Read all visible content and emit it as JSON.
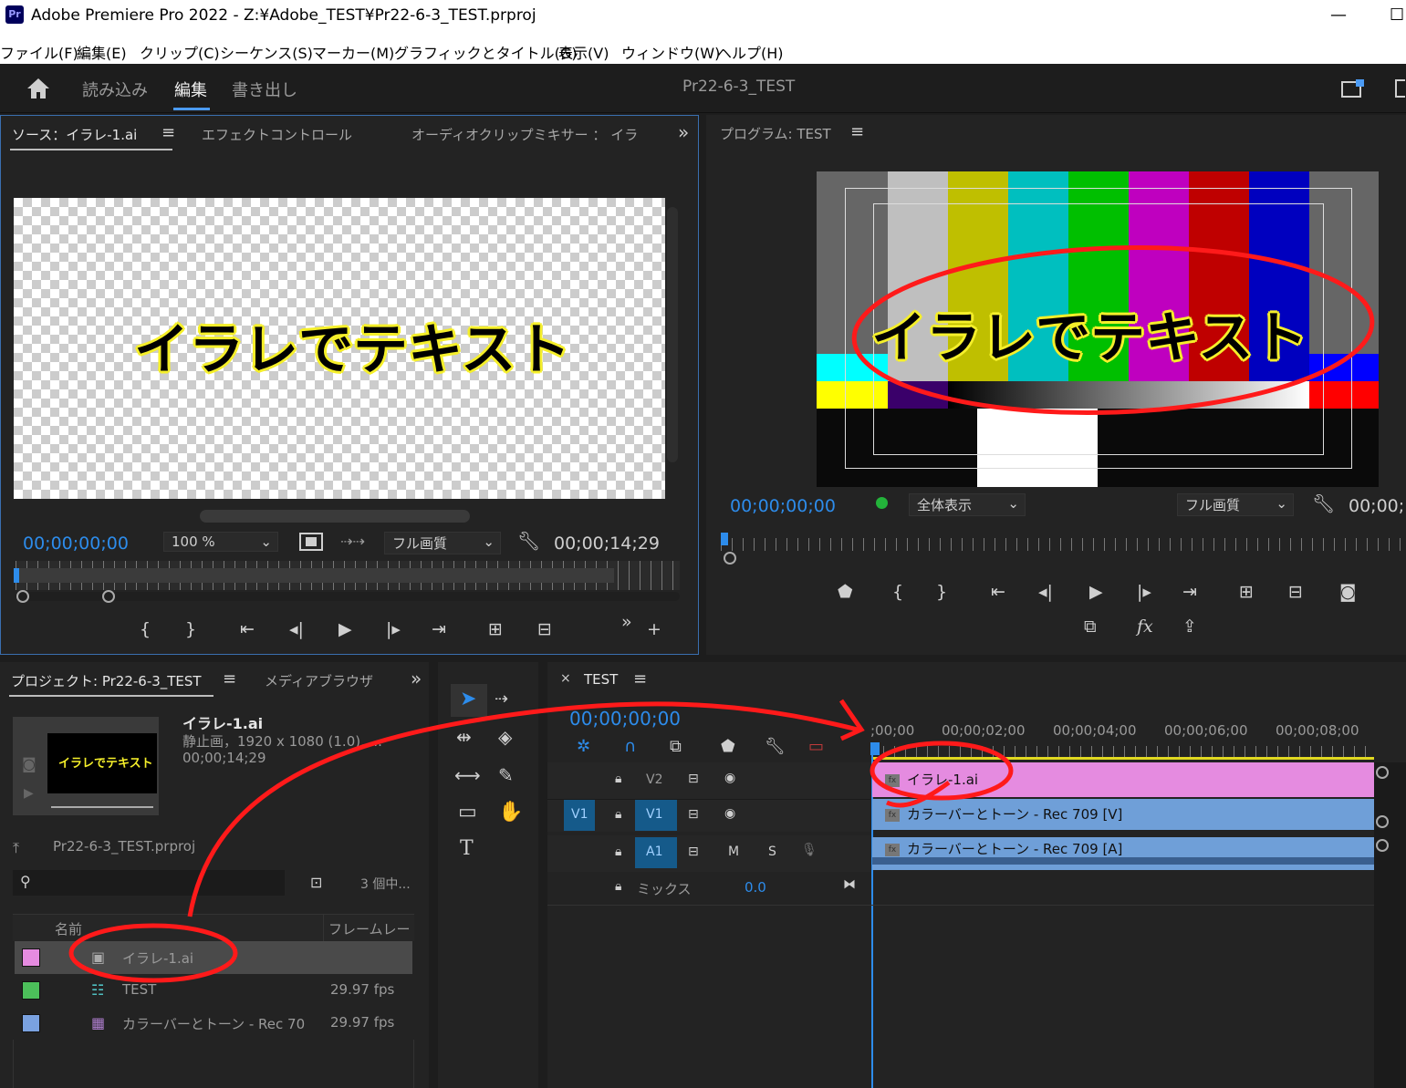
{
  "window": {
    "title": "Adobe Premiere Pro 2022 - Z:¥Adobe_TEST¥Pr22-6-3_TEST.prproj",
    "app_icon": "Pr"
  },
  "menu": [
    "ファイル(F)",
    "編集(E)",
    "クリップ(C)",
    "シーケンス(S)",
    "マーカー(M)",
    "グラフィックとタイトル(G)",
    "表示(V)",
    "ウィンドウ(W)",
    "ヘルプ(H)"
  ],
  "workspace": {
    "tabs": [
      "読み込み",
      "編集",
      "書き出し"
    ],
    "active_tab": "編集",
    "project_name": "Pr22-6-3_TEST"
  },
  "source_panel": {
    "tabs": [
      "ソース：イラレ-1.ai",
      "エフェクトコントロール",
      "オーディオクリップミキサー ： イラ"
    ],
    "preview_text": "イラレでテキスト",
    "timecode_current": "00;00;00;00",
    "zoom": "100 %",
    "quality": "フル画質",
    "duration": "00;00;14;29"
  },
  "program_panel": {
    "title": "プログラム: TEST",
    "overlay_text": "イラレでテキスト",
    "timecode_current": "00;00;00;00",
    "zoom": "全体表示",
    "quality": "フル画質",
    "timecode_right": "00;00;"
  },
  "project_panel": {
    "tabs": [
      "プロジェクト: Pr22-6-3_TEST",
      "メディアブラウザ"
    ],
    "preview": {
      "name": "イラレ-1.ai",
      "info": "静止画，1920 x 1080 (1.0), ...",
      "duration": "00;00;14;29",
      "thumb_text": "イラレでテキスト"
    },
    "bin": "Pr22-6-3_TEST.prproj",
    "item_count": "3 個中...",
    "columns": [
      "名前",
      "フレームレー"
    ],
    "items": [
      {
        "name": "イラレ-1.ai",
        "fps": "",
        "color": "#e58be0"
      },
      {
        "name": "TEST",
        "fps": "29.97 fps",
        "color": "#4cbf5a"
      },
      {
        "name": "カラーバーとトーン - Rec 70",
        "fps": "29.97 fps",
        "color": "#7aa2e0"
      }
    ]
  },
  "timeline": {
    "sequence": "TEST",
    "timecode": "00;00;00;00",
    "ruler": [
      ";00;00",
      "00;00;02;00",
      "00;00;04;00",
      "00;00;06;00",
      "00;00;08;00"
    ],
    "tracks": {
      "v2": "V2",
      "v1_source": "V1",
      "v1": "V1",
      "a1": "A1",
      "mute": "M",
      "solo": "S",
      "mix_label": "ミックス",
      "mix_value": "0.0"
    },
    "clips": {
      "v2": "イラレ-1.ai",
      "v1": "カラーバーとトーン - Rec 709 [V]",
      "a1": "カラーバーとトーン - Rec 709 [A]"
    },
    "colors": {
      "v2": "#e58be0",
      "v1": "#6f9fd8",
      "a1": "#6f9fd8"
    }
  },
  "tools": {
    "type_tool": "T"
  }
}
